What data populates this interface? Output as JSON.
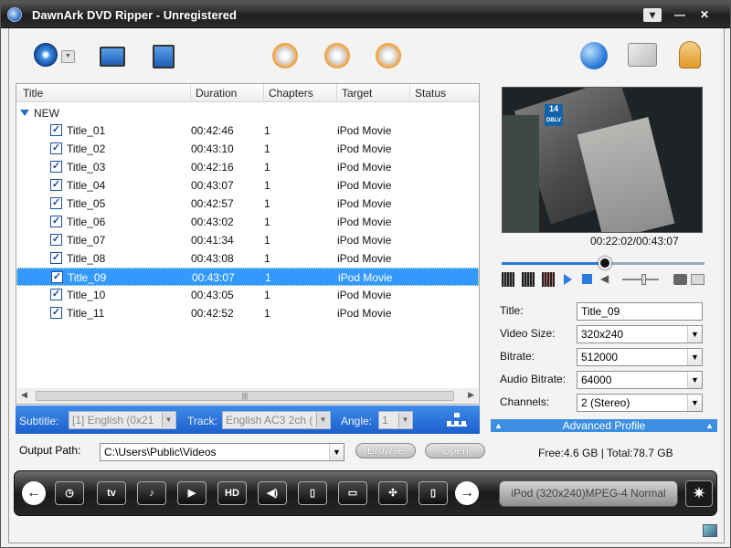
{
  "window": {
    "title": "DawnArk DVD Ripper - Unregistered",
    "controls": [
      "▾",
      "—",
      "✕"
    ]
  },
  "toolbar": {
    "left_icons": [
      "dvd-disc-icon",
      "dropdown-arrow-icon",
      "load-folder-icon",
      "load-file-icon"
    ],
    "center_icons": [
      "convert-disc-icon",
      "pause-disc-icon",
      "stop-disc-icon"
    ],
    "right_icons": [
      "globe-icon",
      "register-icon",
      "help-user-icon"
    ]
  },
  "table": {
    "headers": [
      "Title",
      "Duration",
      "Chapters",
      "Target",
      "Status"
    ],
    "group": "NEW",
    "rows": [
      {
        "title": "Title_01",
        "duration": "00:42:46",
        "chapters": "1",
        "target": "iPod Movie",
        "status": ""
      },
      {
        "title": "Title_02",
        "duration": "00:43:10",
        "chapters": "1",
        "target": "iPod Movie",
        "status": ""
      },
      {
        "title": "Title_03",
        "duration": "00:42:16",
        "chapters": "1",
        "target": "iPod Movie",
        "status": ""
      },
      {
        "title": "Title_04",
        "duration": "00:43:07",
        "chapters": "1",
        "target": "iPod Movie",
        "status": ""
      },
      {
        "title": "Title_05",
        "duration": "00:42:57",
        "chapters": "1",
        "target": "iPod Movie",
        "status": ""
      },
      {
        "title": "Title_06",
        "duration": "00:43:02",
        "chapters": "1",
        "target": "iPod Movie",
        "status": ""
      },
      {
        "title": "Title_07",
        "duration": "00:41:34",
        "chapters": "1",
        "target": "iPod Movie",
        "status": ""
      },
      {
        "title": "Title_08",
        "duration": "00:43:08",
        "chapters": "1",
        "target": "iPod Movie",
        "status": ""
      },
      {
        "title": "Title_09",
        "duration": "00:43:07",
        "chapters": "1",
        "target": "iPod Movie",
        "status": ""
      },
      {
        "title": "Title_10",
        "duration": "00:43:05",
        "chapters": "1",
        "target": "iPod Movie",
        "status": ""
      },
      {
        "title": "Title_11",
        "duration": "00:42:52",
        "chapters": "1",
        "target": "iPod Movie",
        "status": ""
      }
    ],
    "selected_row": "Title_09",
    "scroll_grip": "|||"
  },
  "track_bar": {
    "subtitle_label": "Subtitle:",
    "subtitle_value": "[1] English (0x21",
    "track_label": "Track:",
    "track_value": "English AC3 2ch (",
    "angle_label": "Angle:",
    "angle_value": "1"
  },
  "preview": {
    "time": "00:22:02/00:43:07",
    "channel_logo_top": "14",
    "channel_logo_bottom": "DBLV",
    "progress": 0.51,
    "volume": 0.6
  },
  "properties": {
    "title_label": "Title:",
    "title_value": "Title_09",
    "video_size_label": "Video Size:",
    "video_size_value": "320x240",
    "bitrate_label": "Bitrate:",
    "bitrate_value": "512000",
    "audio_bitrate_label": "Audio Bitrate:",
    "audio_bitrate_value": "64000",
    "channels_label": "Channels:",
    "channels_value": "2 (Stereo)",
    "advanced_label": "Advanced Profile"
  },
  "output": {
    "label": "Output Path:",
    "path": "C:\\Users\\Public\\Videos",
    "browse": "Browse",
    "open": "Open"
  },
  "disk": {
    "text": "Free:4.6 GB | Total:78.7 GB"
  },
  "dock": {
    "prev": "←",
    "next": "→",
    "apple_tv": "tv",
    "hd": "HD",
    "profile": "iPod (320x240)MPEG-4 Normal"
  }
}
